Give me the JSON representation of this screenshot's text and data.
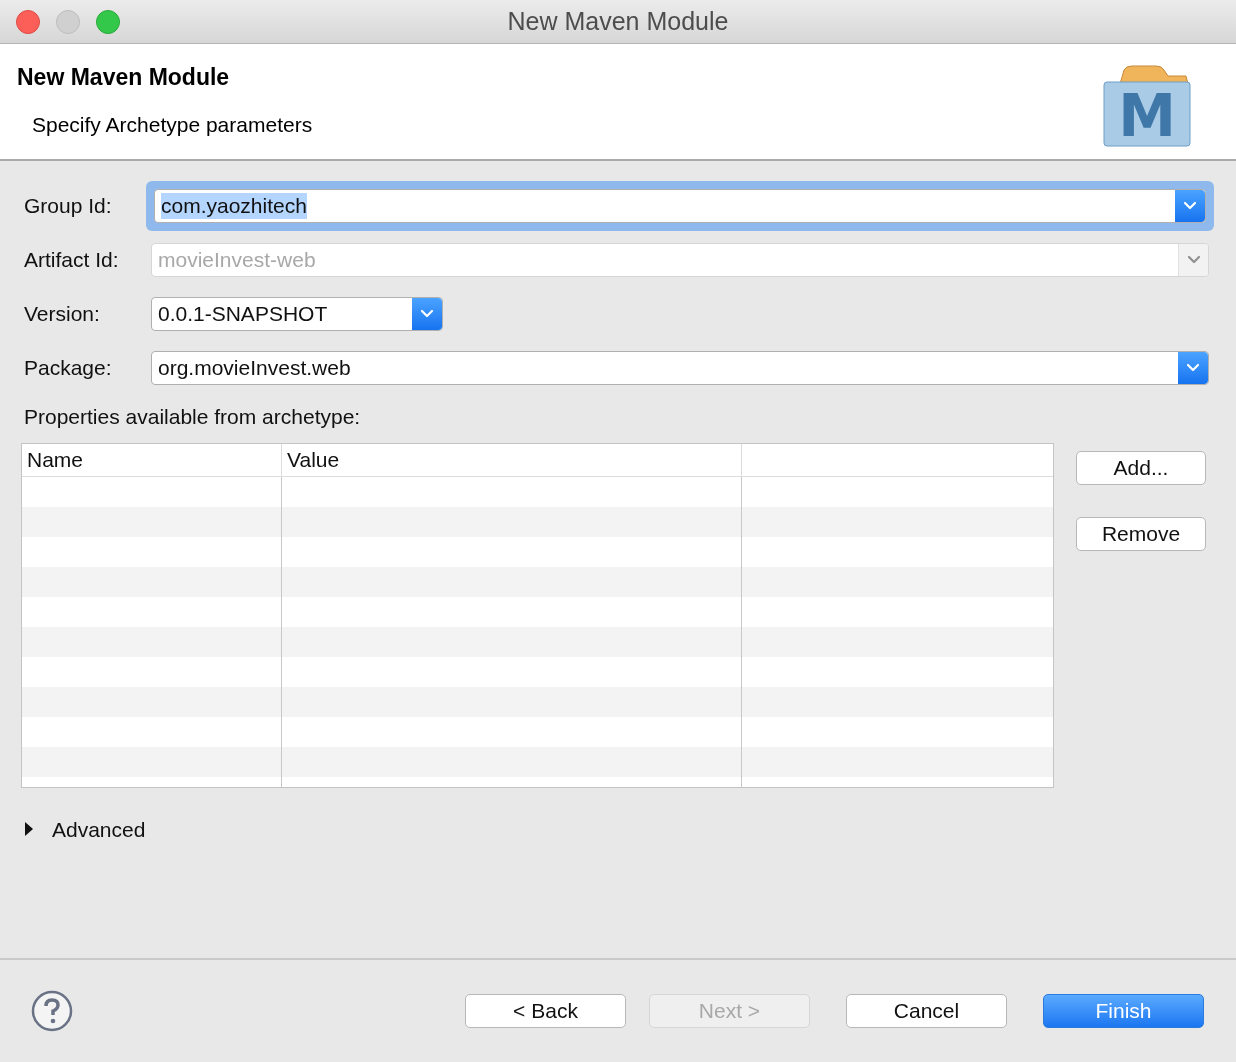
{
  "window": {
    "title": "New Maven Module"
  },
  "header": {
    "title": "New Maven Module",
    "subtitle": "Specify Archetype parameters",
    "logo_letter": "M"
  },
  "fields": [
    {
      "label": "Group Id:",
      "value": "com.yaozhitech",
      "kind": "combo",
      "focused": true,
      "disabled": false
    },
    {
      "label": "Artifact Id:",
      "value": "movieInvest-web",
      "kind": "combo",
      "focused": false,
      "disabled": true
    },
    {
      "label": "Version:",
      "value": "0.0.1-SNAPSHOT",
      "kind": "short_combo",
      "focused": false,
      "disabled": false
    },
    {
      "label": "Package:",
      "value": "org.movieInvest.web",
      "kind": "combo",
      "focused": false,
      "disabled": false
    }
  ],
  "properties": {
    "label": "Properties available from archetype:",
    "columns": [
      "Name",
      "Value"
    ],
    "buttons": [
      {
        "label": "Add...",
        "disabled": false
      },
      {
        "label": "Remove",
        "disabled": false
      }
    ]
  },
  "advanced": {
    "label": "Advanced",
    "expanded": false
  },
  "footer": {
    "buttons": [
      {
        "label": "< Back",
        "disabled": false,
        "default": false
      },
      {
        "label": "Next >",
        "disabled": true,
        "default": false
      },
      {
        "label": "Cancel",
        "disabled": false,
        "default": false
      },
      {
        "label": "Finish",
        "disabled": false,
        "default": true
      }
    ]
  }
}
